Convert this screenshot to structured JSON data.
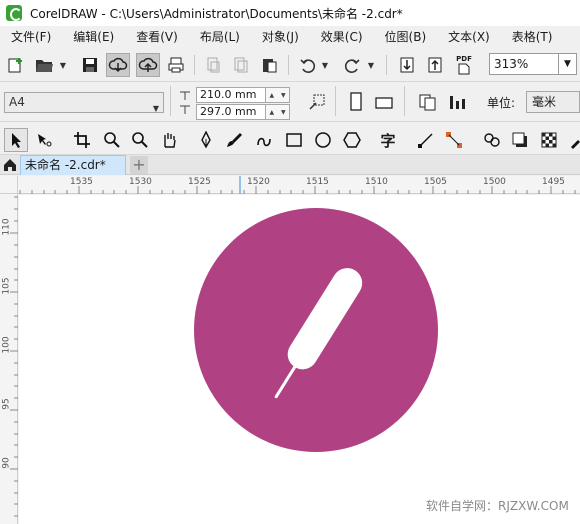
{
  "window": {
    "title": "CorelDRAW - C:\\Users\\Administrator\\Documents\\未命名 -2.cdr*"
  },
  "menu": [
    {
      "label": "文件(F)"
    },
    {
      "label": "编辑(E)"
    },
    {
      "label": "查看(V)"
    },
    {
      "label": "布局(L)"
    },
    {
      "label": "对象(J)"
    },
    {
      "label": "效果(C)"
    },
    {
      "label": "位图(B)"
    },
    {
      "label": "文本(X)"
    },
    {
      "label": "表格(T)"
    }
  ],
  "toolbar": {
    "zoom": "313%",
    "pdf_label": "PDF"
  },
  "property_bar": {
    "page_size": "A4",
    "width": "210.0 mm",
    "height": "297.0 mm",
    "units_label": "单位:",
    "units_value": "毫米"
  },
  "toolbox": {
    "text_tool_glyph": "字"
  },
  "tabs": {
    "document": "未命名 -2.cdr*",
    "add": "+"
  },
  "ruler": {
    "horizontal": [
      "1535",
      "1530",
      "1525",
      "1520",
      "1515",
      "1510",
      "1505",
      "1500",
      "1495"
    ],
    "vertical": [
      "110",
      "105",
      "100",
      "95",
      "90"
    ]
  },
  "artwork": {
    "circle_color": "#b04283",
    "shape_color": "#ffffff"
  },
  "watermark": "软件自学网：RJZXW.COM"
}
